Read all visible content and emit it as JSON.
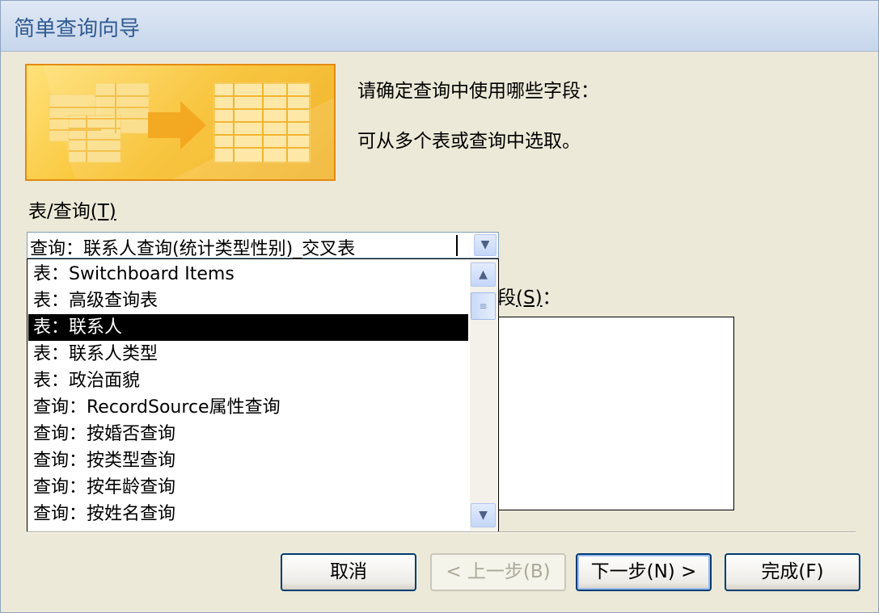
{
  "window": {
    "title": "简单查询向导"
  },
  "instructions": {
    "line1": "请确定查询中使用哪些字段：",
    "line2": "可从多个表或查询中选取。"
  },
  "table_query": {
    "label": "表/查询",
    "accel": "(T)",
    "selected_value": "查询：联系人查询(统计类型性别)_交叉表",
    "options": [
      "表：Switchboard Items",
      "表：高级查询表",
      "表：联系人",
      "表：联系人类型",
      "表：政治面貌",
      "查询：RecordSource属性查询",
      "查询：按婚否查询",
      "查询：按类型查询",
      "查询：按年龄查询",
      "查询：按姓名查询"
    ],
    "highlighted_index": 2
  },
  "available_fields": {
    "label_tail": "段",
    "accel": "(S)",
    "suffix": "："
  },
  "buttons": {
    "cancel": "取消",
    "back": "< 上一步(B)",
    "next": "下一步(N) >",
    "finish": "完成(F)"
  },
  "colors": {
    "selection": "#000000",
    "button_border": "#003c74",
    "banner": "#f8c02c"
  }
}
